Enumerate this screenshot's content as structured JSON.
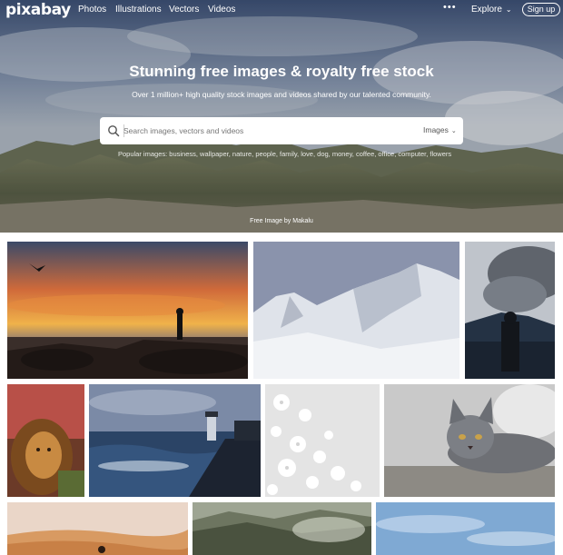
{
  "nav": {
    "logo": "pixabay",
    "links": [
      "Photos",
      "Illustrations",
      "Vectors",
      "Videos"
    ],
    "more_icon": "•••",
    "explore": "Explore",
    "signup": "Sign up"
  },
  "hero": {
    "title": "Stunning free images & royalty free stock",
    "subtitle": "Over 1 million+ high quality stock images and videos shared by our talented community.",
    "search_placeholder": "Search images, vectors and videos",
    "search_type": "Images",
    "popular": "Popular images: business, wallpaper, nature, people, family, love, dog, money, coffee, office, computer, flowers",
    "credit": "Free Image by Makalu"
  },
  "colors": {
    "hero_sky": "#7d8fae",
    "hero_mountain": "#59614a"
  },
  "grid": {
    "tiles": [
      "sunset-beach-silhouette-photo",
      "snowy-mountain-peaks-photo",
      "volcano-smoke-photo",
      "lion-photo",
      "pier-lighthouse-photo",
      "white-paper-flowers-photo",
      "grey-cat-photo",
      "desert-dunes-photo",
      "misty-mountains-photo",
      "blue-sky-photo"
    ]
  }
}
